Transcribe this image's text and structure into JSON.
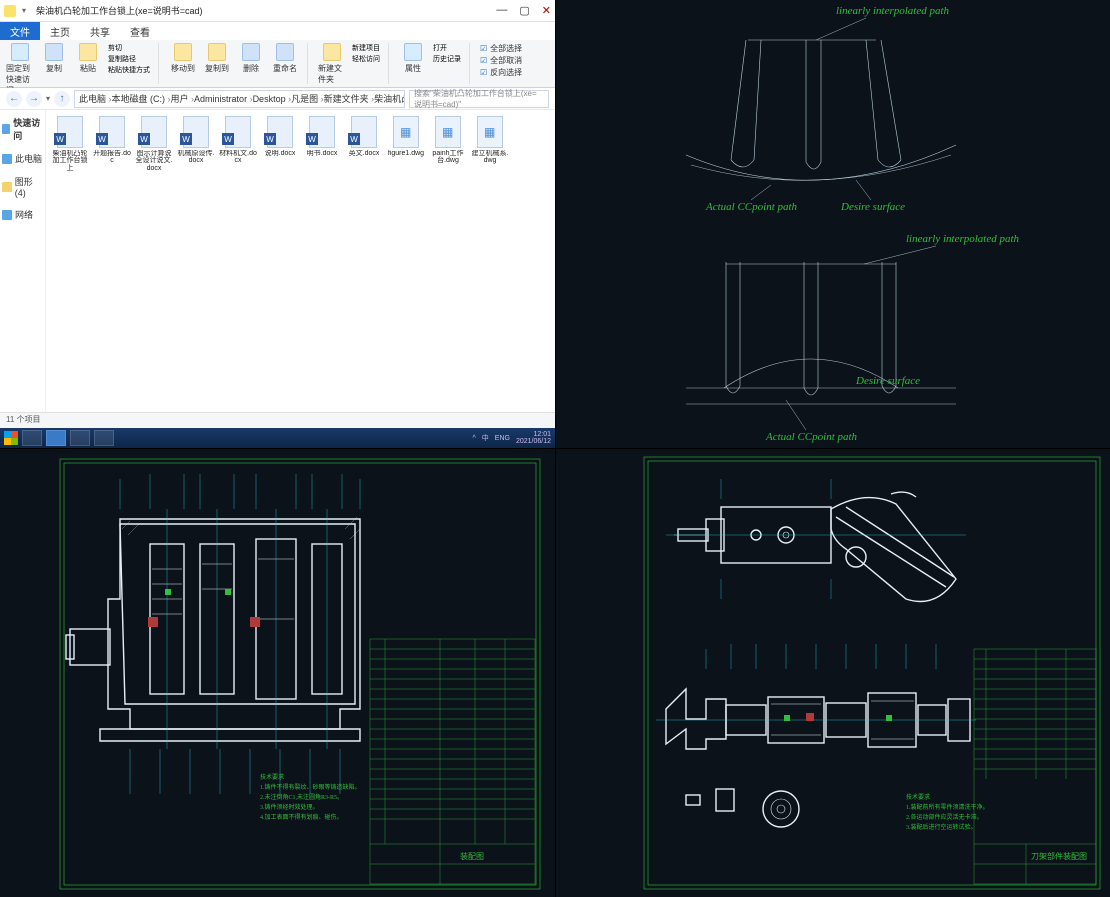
{
  "explorer": {
    "title": "柴油机凸轮加工作台锁上(xe=说明书=cad)",
    "tabs": {
      "file": "文件",
      "home": "主页",
      "share": "共享",
      "view": "查看"
    },
    "ribbon": {
      "pin": "固定到快速访问",
      "copy": "复制",
      "paste": "粘贴",
      "cut": "剪切",
      "copypath": "复制路径",
      "pasteshort": "粘贴快捷方式",
      "moveto": "移动到",
      "copyto": "复制到",
      "delete": "删除",
      "rename": "重命名",
      "newfolder": "新建文件夹",
      "newitem": "新建项目",
      "easyaccess": "轻松访问",
      "properties": "属性",
      "open": "打开",
      "history": "历史记录",
      "selectall": "全部选择",
      "selectnone": "全部取消",
      "invert": "反向选择"
    },
    "breadcrumbs": [
      "此电脑",
      "本地磁盘 (C:)",
      "用户",
      "Administrator",
      "Desktop",
      "凡是图",
      "新建文件夹",
      "柴油机凸轮加工作台锁上(xe=说明书=cad)"
    ],
    "search_placeholder": "搜索\"柴油机凸轮加工作台锁上(xe=说明书=cad)\"",
    "nav": {
      "quick": "快速访问",
      "desktop": "此电脑",
      "pictures": "图形(4)",
      "network": "网络"
    },
    "files": [
      {
        "name": "柴油机凸轮加工作台锁上",
        "type": "word"
      },
      {
        "name": "开题报告.doc",
        "type": "word"
      },
      {
        "name": "图示计算说全设计说文.docx",
        "type": "word"
      },
      {
        "name": "机械原设传.docx",
        "type": "word"
      },
      {
        "name": "材料机文.docx",
        "type": "word"
      },
      {
        "name": "说明.docx",
        "type": "word"
      },
      {
        "name": "明书.docx",
        "type": "word"
      },
      {
        "name": "英文.docx",
        "type": "word"
      },
      {
        "name": "figure1.dwg",
        "type": "dwg"
      },
      {
        "name": "painh工作台.dwg",
        "type": "dwg"
      },
      {
        "name": "建立机械系.dwg",
        "type": "dwg"
      }
    ],
    "status": "11 个项目",
    "tray": {
      "ime": "中",
      "lang": "ENG",
      "time": "12:01",
      "date": "2021/06/12"
    }
  },
  "diagram": {
    "labels": {
      "lin1": "linearly interpolated path",
      "lin2": "linearly interpolated path",
      "cc1": "Actual CCpoint path",
      "des1": "Desire surface",
      "cc2": "Actual CCpoint path",
      "des2": "Desire surface"
    }
  },
  "cad_c": {
    "notes": [
      "技术要求",
      "1.铸件不得有裂纹、砂眼等铸造缺陷。",
      "2.未注倒角C1,未注圆角R3-R5。",
      "3.铸件须经时效处理。",
      "4.加工表面不得有划痕、碰伤。"
    ],
    "titleblock": "装配图"
  },
  "cad_d": {
    "notes": [
      "技术要求",
      "1.装配前所有零件须清洗干净。",
      "2.各运动部件应灵活无卡滞。",
      "3.装配后进行空运转试验。"
    ],
    "titleblock": "刀架部件装配图"
  }
}
